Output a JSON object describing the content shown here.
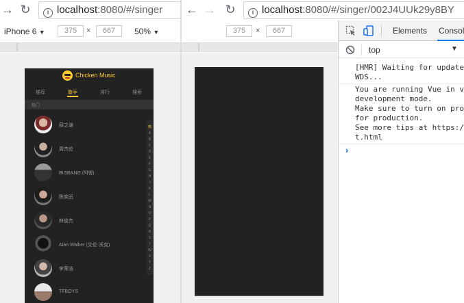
{
  "left_window": {
    "url_host": "localhost",
    "url_rest": ":8080/#/singer",
    "device": "iPhone 6",
    "width": "375",
    "height": "667",
    "zoom": "50%",
    "times": "×"
  },
  "phone": {
    "title": "Chicken Music",
    "tabs": [
      "推荐",
      "歌手",
      "排行",
      "搜索"
    ],
    "active_tab": 1,
    "group_title": "热门",
    "singers": [
      {
        "name": "薛之谦"
      },
      {
        "name": "周杰伦"
      },
      {
        "name": "BIGBANG (빅뱅)"
      },
      {
        "name": "陈奕迅"
      },
      {
        "name": "林俊杰"
      },
      {
        "name": "Alan Walker (艾伦·沃克)"
      },
      {
        "name": "李荣浩"
      },
      {
        "name": "TFBOYS"
      }
    ],
    "shortcut": [
      "热",
      "A",
      "B",
      "C",
      "D",
      "E",
      "F",
      "G",
      "H",
      "J",
      "K",
      "L",
      "M",
      "N",
      "O",
      "P",
      "Q",
      "R",
      "S",
      "T",
      "W",
      "X",
      "Y",
      "Z"
    ]
  },
  "right_window": {
    "url_host": "localhost",
    "url_rest": ":8080/#/singer/002J4UUk29y8BY",
    "width": "375",
    "height": "667",
    "times": "×"
  },
  "devtools": {
    "tabs": [
      "Elements",
      "Consol"
    ],
    "active_tab": 1,
    "context": "top",
    "messages": [
      "[HMR] Waiting for update\nWDS...",
      "You are running Vue in vi\ndevelopment mode.\nMake sure to turn on pro\nfor production.\nSee more tips at https:/\nt.html"
    ],
    "prompt": "›"
  },
  "colors": {
    "accent": "#ffcd32",
    "phone_bg": "#222222",
    "devtools_blue": "#1a73e8"
  }
}
